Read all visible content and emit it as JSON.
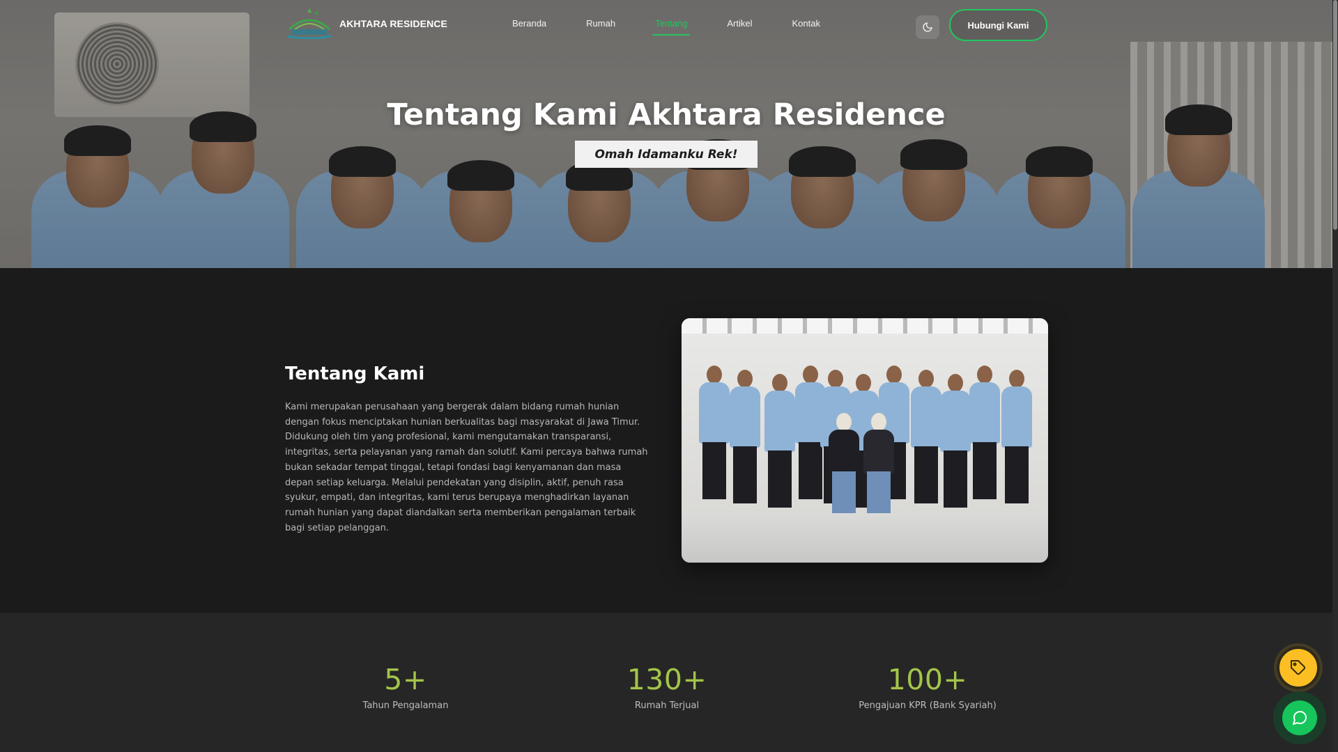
{
  "navbar": {
    "brand_name": "AKHTARA RESIDENCE",
    "links": [
      {
        "label": "Beranda"
      },
      {
        "label": "Rumah"
      },
      {
        "label": "Tentang",
        "active": true
      },
      {
        "label": "Artikel"
      },
      {
        "label": "Kontak"
      }
    ],
    "theme_toggle_icon": "moon-icon",
    "cta_label": "Hubungi Kami"
  },
  "hero": {
    "title": "Tentang Kami Akhtara Residence",
    "tagline": "Omah Idamanku Rek!"
  },
  "about": {
    "heading": "Tentang Kami",
    "body": "Kami merupakan perusahaan yang bergerak dalam bidang rumah hunian dengan fokus menciptakan hunian berkualitas bagi masyarakat di Jawa Timur. Didukung oleh tim yang profesional, kami mengutamakan transparansi, integritas, serta pelayanan yang ramah dan solutif. Kami percaya bahwa rumah bukan sekadar tempat tinggal, tetapi fondasi bagi kenyamanan dan masa depan setiap keluarga. Melalui pendekatan yang disiplin, aktif, penuh rasa syukur, empati, dan integritas, kami terus berupaya menghadirkan layanan rumah hunian yang dapat diandalkan serta memberikan pengalaman terbaik bagi setiap pelanggan."
  },
  "stats": [
    {
      "value": "5+",
      "label": "Tahun Pengalaman"
    },
    {
      "value": "130+",
      "label": "Rumah Terjual"
    },
    {
      "value": "100+",
      "label": "Pengajuan KPR (Bank Syariah)"
    }
  ],
  "floating": {
    "promo_icon": "tag-icon",
    "chat_icon": "chat-icon"
  },
  "colors": {
    "accent": "#22c55e",
    "stat_value": "#a3c54a",
    "promo": "#fbbf24",
    "background": "#1b1b1b"
  }
}
